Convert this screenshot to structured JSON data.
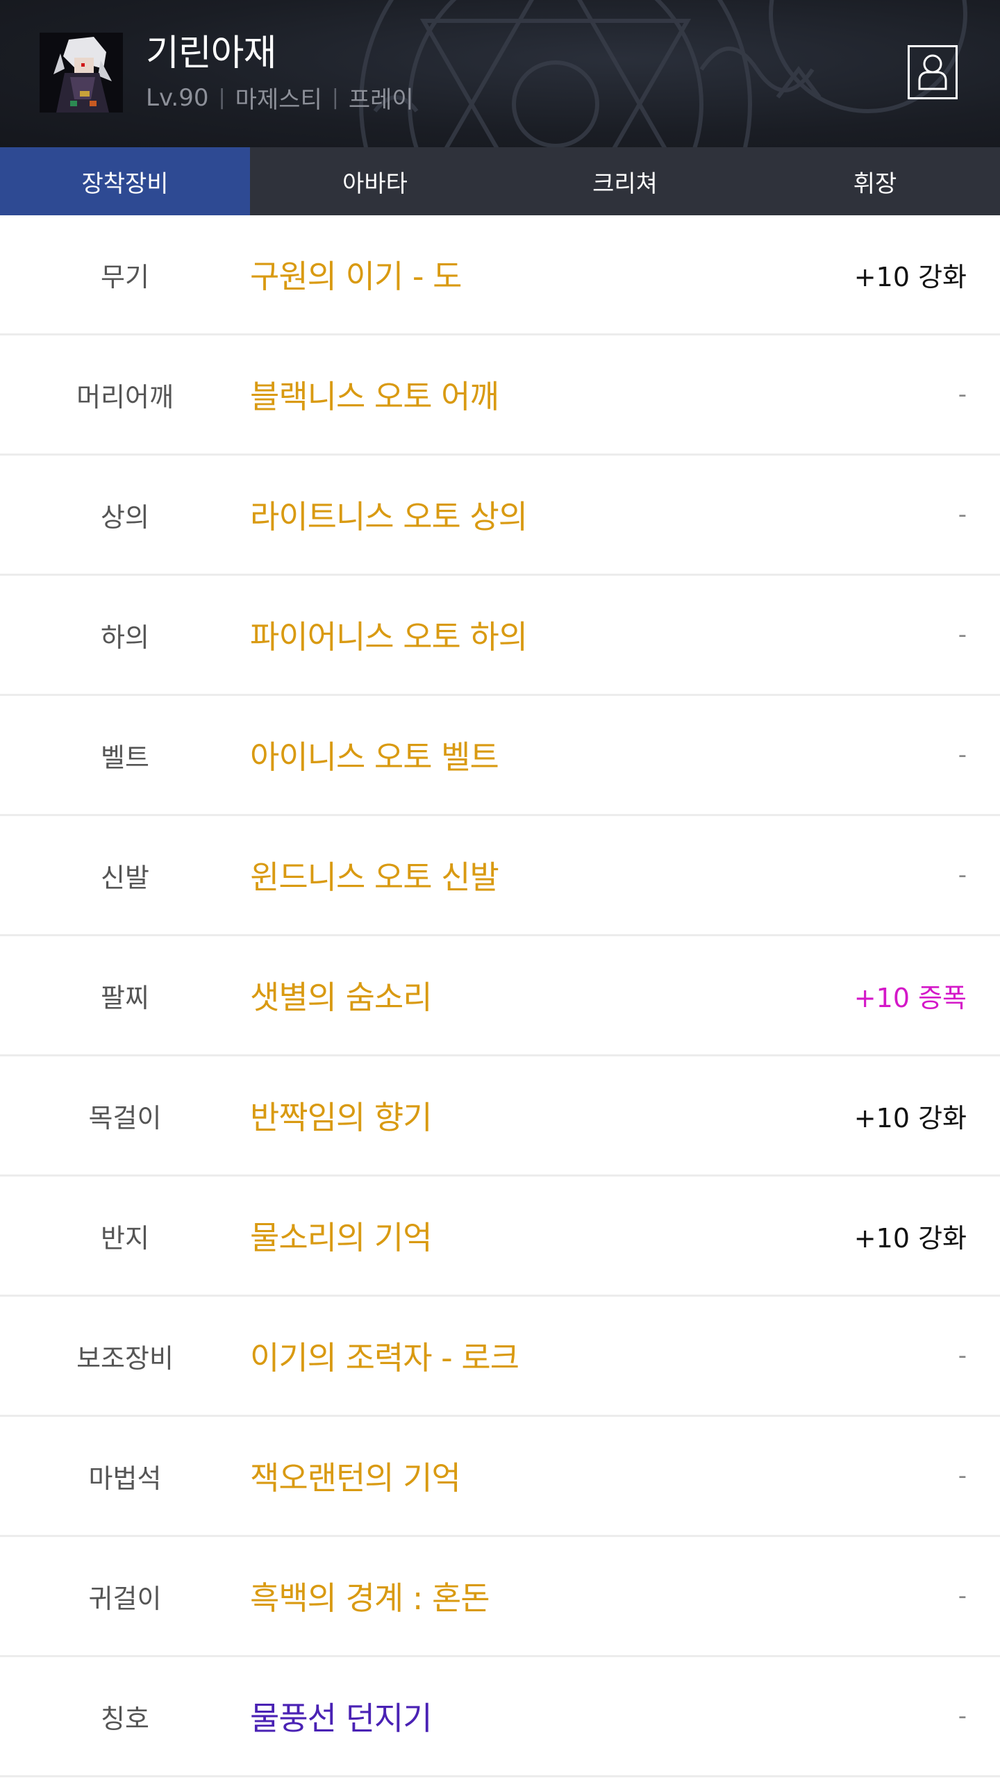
{
  "profile": {
    "name": "기린아재",
    "level": "Lv.90",
    "job": "마제스티",
    "server": "프레이"
  },
  "tabs": [
    {
      "label": "장착장비",
      "active": true
    },
    {
      "label": "아바타",
      "active": false
    },
    {
      "label": "크리쳐",
      "active": false
    },
    {
      "label": "휘장",
      "active": false
    }
  ],
  "colors": {
    "item_name": "#d99a12",
    "title_item": "#4a22b4",
    "amplify": "#d418c8",
    "active_tab": "#2e4a93"
  },
  "equipment": [
    {
      "slot": "무기",
      "item": "구원의 이기 - 도",
      "upgrade": "+10 강화"
    },
    {
      "slot": "머리어깨",
      "item": "블랙니스 오토 어깨",
      "upgrade": "-"
    },
    {
      "slot": "상의",
      "item": "라이트니스 오토 상의",
      "upgrade": "-"
    },
    {
      "slot": "하의",
      "item": "파이어니스 오토 하의",
      "upgrade": "-"
    },
    {
      "slot": "벨트",
      "item": "아이니스 오토 벨트",
      "upgrade": "-"
    },
    {
      "slot": "신발",
      "item": "윈드니스 오토 신발",
      "upgrade": "-"
    },
    {
      "slot": "팔찌",
      "item": "샛별의 숨소리",
      "upgrade": "+10 증폭"
    },
    {
      "slot": "목걸이",
      "item": "반짝임의 향기",
      "upgrade": "+10 강화"
    },
    {
      "slot": "반지",
      "item": "물소리의 기억",
      "upgrade": "+10 강화"
    },
    {
      "slot": "보조장비",
      "item": "이기의 조력자 - 로크",
      "upgrade": "-"
    },
    {
      "slot": "마법석",
      "item": "잭오랜턴의 기억",
      "upgrade": "-"
    },
    {
      "slot": "귀걸이",
      "item": "흑백의 경계 : 혼돈",
      "upgrade": "-"
    },
    {
      "slot": "칭호",
      "item": "물풍선 던지기",
      "upgrade": "-"
    }
  ]
}
